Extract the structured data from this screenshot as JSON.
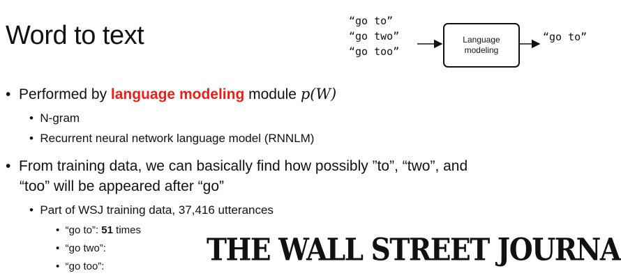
{
  "slide": {
    "title": "Word to text",
    "diagram": {
      "inputs": [
        "“go to”",
        "“go two”",
        "“go too”"
      ],
      "box_line1": "Language",
      "box_line2": "modeling",
      "output": "“go to”"
    },
    "bullet1": {
      "prefix": "Performed by ",
      "highlight": "language modeling",
      "suffix": " module ",
      "math": "p(W)",
      "sub": [
        "N-gram",
        "Recurrent neural network language model (RNNLM)"
      ]
    },
    "bullet2": {
      "line1": "From training data, we can basically find how possibly ”to”, “two”, and",
      "line2": "“too” will be appeared after “go”",
      "sub": "Part of WSJ training data, 37,416 utterances",
      "counts": [
        {
          "label": "“go to”: ",
          "count": "51",
          "unit": " times"
        },
        {
          "label": "“go two”:",
          "count": "",
          "unit": ""
        },
        {
          "label": "“go too”:",
          "count": "",
          "unit": ""
        }
      ]
    },
    "logo_text": "THE WALL STREET JOURNAL."
  }
}
